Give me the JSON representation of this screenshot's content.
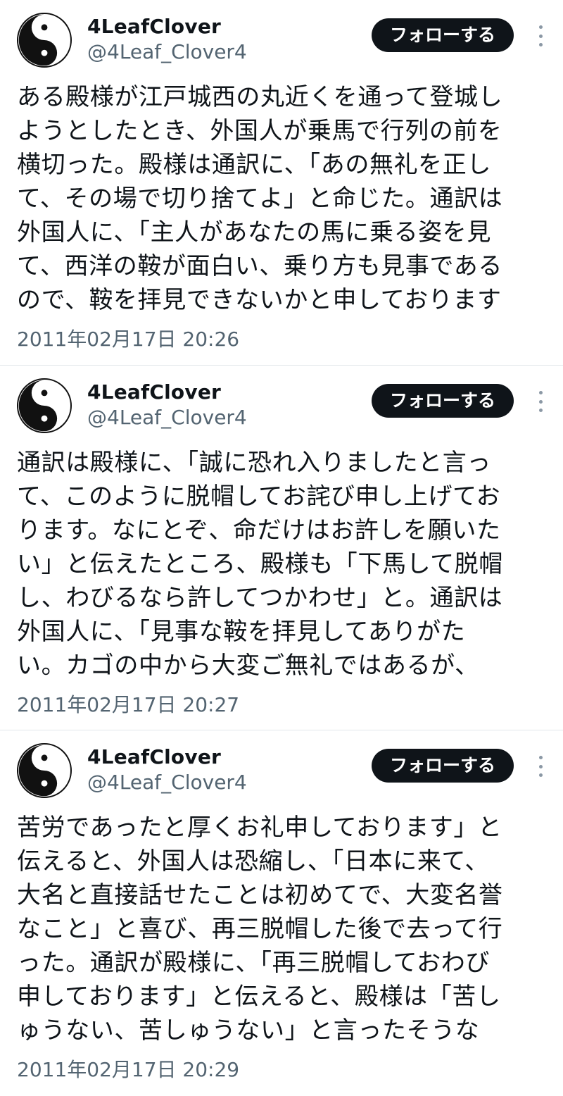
{
  "tweets": [
    {
      "display_name": "4LeafClover",
      "handle": "@4Leaf_Clover4",
      "follow_label": "フォローする",
      "avatar_icon": "yin-yang-icon",
      "more_icon": "more-options-icon",
      "body": "ある殿様が江戸城西の丸近くを通って登城し\nようとしたとき、外国人が乗馬で行列の前を\n横切った。殿様は通訳に、「あの無礼を正し\nて、その場で切り捨てよ」と命じた。通訳は\n外国人に、「主人があなたの馬に乗る姿を見\nて、西洋の鞍が面白い、乗り方も見事である\nので、鞍を拝見できないかと申しております",
      "timestamp": "2011年02月17日 20:26"
    },
    {
      "display_name": "4LeafClover",
      "handle": "@4Leaf_Clover4",
      "follow_label": "フォローする",
      "avatar_icon": "yin-yang-icon",
      "more_icon": "more-options-icon",
      "body": "通訳は殿様に、「誠に恐れ入りましたと言っ\nて、このように脱帽してお詫び申し上げてお\nります。なにとぞ、命だけはお許しを願いた\nい」と伝えたところ、殿様も「下馬して脱帽\nし、わびるなら許してつかわせ」と。通訳は\n外国人に、「見事な鞍を拝見してありがた\nい。カゴの中から大変ご無礼ではあるが、",
      "timestamp": "2011年02月17日 20:27"
    },
    {
      "display_name": "4LeafClover",
      "handle": "@4Leaf_Clover4",
      "follow_label": "フォローする",
      "avatar_icon": "yin-yang-icon",
      "more_icon": "more-options-icon",
      "body": "苦労であったと厚くお礼申しております」と\n伝えると、外国人は恐縮し、「日本に来て、\n大名と直接話せたことは初めてで、大変名誉\nなこと」と喜び、再三脱帽した後で去って行\nった。通訳が殿様に、「再三脱帽しておわび\n申しております」と伝えると、殿様は「苦し\nゅうない、苦しゅうない」と言ったそうな",
      "timestamp": "2011年02月17日 20:29"
    }
  ],
  "colors": {
    "text": "#0f1419",
    "secondary": "#536471",
    "button_bg": "#0f1419",
    "button_text": "#ffffff",
    "divider": "#e1e6ea"
  }
}
